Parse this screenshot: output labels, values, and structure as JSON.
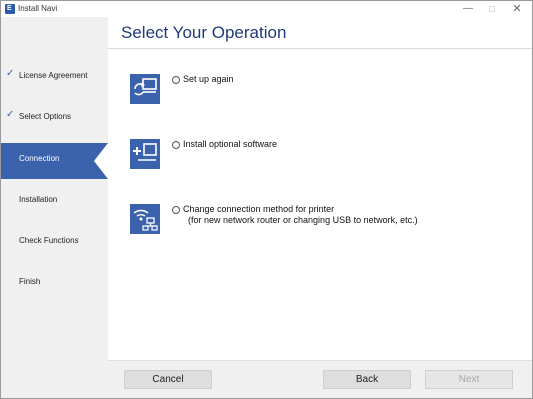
{
  "window": {
    "title": "Install Navi",
    "app_icon_letter": "E"
  },
  "title_buttons": {
    "minimize": "—",
    "maximize": "□",
    "close": "✕"
  },
  "sidebar": {
    "items": [
      {
        "label": "License Agreement",
        "checked": true,
        "active": false
      },
      {
        "label": "Select Options",
        "checked": true,
        "active": false
      },
      {
        "label": "Connection",
        "checked": false,
        "active": true
      },
      {
        "label": "Installation",
        "checked": false,
        "active": false
      },
      {
        "label": "Check Functions",
        "checked": false,
        "active": false
      },
      {
        "label": "Finish",
        "checked": false,
        "active": false
      }
    ],
    "check_glyph": "✓"
  },
  "header": {
    "title": "Select Your Operation"
  },
  "options": [
    {
      "line1": "Set up again",
      "line2": "",
      "icon": "setup-again-icon",
      "selected": false
    },
    {
      "line1": "Install optional software",
      "line2": "",
      "icon": "install-software-icon",
      "selected": false
    },
    {
      "line1": "Change connection method for printer",
      "line2": "(for new network router or changing USB to network, etc.)",
      "icon": "network-connection-icon",
      "selected": false
    }
  ],
  "footer": {
    "cancel_label": "Cancel",
    "back_label": "Back",
    "next_label": "Next",
    "next_enabled": false
  },
  "colors": {
    "accent": "#3b63ad",
    "title": "#1f3a7a",
    "sidebar_bg": "#f0f0f0"
  }
}
